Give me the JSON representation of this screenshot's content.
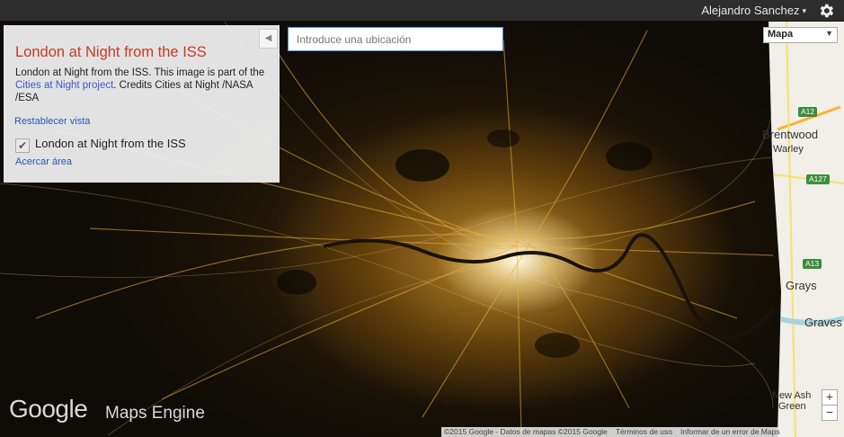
{
  "topbar": {
    "user_name": "Alejandro Sanchez",
    "settings_icon": "gear-icon"
  },
  "panel": {
    "title": "London at Night from the ISS",
    "desc_before": "London at Night from the ISS. This image is part of the ",
    "desc_link": "Cities at Night project",
    "desc_after": ". Credits Cities at Night /NASA /ESA",
    "reset_link": "Restablecer vista",
    "layer_label": "London at Night from the ISS",
    "layer_checked": true,
    "zoom_link": "Acercar área",
    "collapse_icon": "chevron-left-icon"
  },
  "search": {
    "placeholder": "Introduce una ubicación"
  },
  "map_type": {
    "selected": "Mapa"
  },
  "map_labels": {
    "a12": "A12",
    "brentwood": "Brentwood",
    "warley": "Warley",
    "a127": "A127",
    "a13": "A13",
    "grays": "Grays",
    "gravesend": "Graves",
    "new_ash": "New Ash",
    "green": "Green"
  },
  "zoom": {
    "in": "+",
    "out": "−"
  },
  "logo": {
    "google": "Google",
    "product": "Maps Engine"
  },
  "attribution": {
    "data": "©2015 Google - Datos de mapas ©2015 Google",
    "terms": "Términos de uso",
    "report": "Informar de un error de Maps"
  },
  "colors": {
    "panel_title": "#c83a25",
    "link": "#2855b4",
    "search_border": "#4d90fe"
  }
}
